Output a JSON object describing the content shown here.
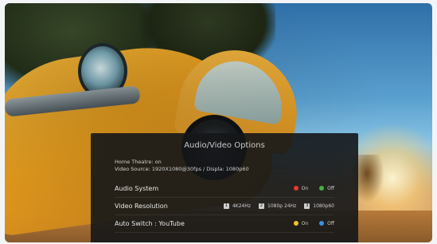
{
  "dialog": {
    "title": "Audio/Video Options",
    "info": {
      "line1": "Home Theatre: on",
      "line2": "Video Source: 1920X1080@30fps / Displa: 1080p60"
    }
  },
  "rows": [
    {
      "label": "Audio System",
      "options": [
        {
          "label": "On",
          "color": "#e53935"
        },
        {
          "label": "Off",
          "color": "#43b047"
        }
      ]
    },
    {
      "label": "Video Resolution",
      "options": [
        {
          "num": "1",
          "label": "4K24Hz"
        },
        {
          "num": "2",
          "label": "1080p 24Hz"
        },
        {
          "num": "3",
          "label": "1080p60"
        }
      ]
    },
    {
      "label": "Auto Switch : YouTube",
      "options": [
        {
          "label": "On",
          "color": "#f2c12e"
        },
        {
          "label": "Off",
          "color": "#3b8fe0"
        }
      ]
    }
  ]
}
